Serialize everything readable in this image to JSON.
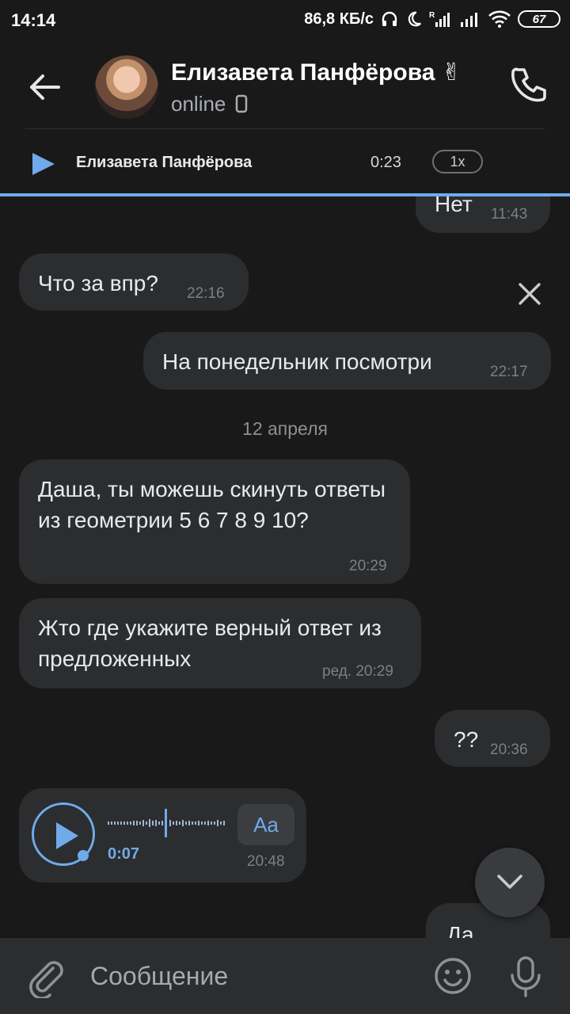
{
  "status_bar": {
    "time": "14:14",
    "network_speed": "86,8 КБ/с",
    "battery": "67"
  },
  "header": {
    "contact_name": "Елизавета Панфёрова ✌",
    "presence": "online"
  },
  "audio_player": {
    "title": "Елизавета Панфёрова",
    "time": "0:23",
    "speed": "1x"
  },
  "messages": [
    {
      "id": "m1",
      "direction": "out",
      "text": "Нет",
      "time": "11:43"
    },
    {
      "id": "m2",
      "direction": "in",
      "text": "Что за впр?",
      "time": "22:16"
    },
    {
      "id": "m3",
      "direction": "out",
      "text": "На понедельник посмотри",
      "time": "22:17"
    },
    {
      "id": "sep",
      "type": "date",
      "text": "12 апреля"
    },
    {
      "id": "m4",
      "direction": "in",
      "text": "Даша, ты можешь скинуть ответы из геометрии 5 6 7 8 9 10?",
      "time": "20:29"
    },
    {
      "id": "m5",
      "direction": "in",
      "text": "Жто где укажите верный ответ из предложенных",
      "time": "ред. 20:29"
    },
    {
      "id": "m6",
      "direction": "out",
      "text": "??",
      "time": "20:36"
    },
    {
      "id": "m7",
      "direction": "in",
      "type": "voice",
      "duration": "0:07",
      "transcribe_label": "Aa",
      "time": "20:48"
    },
    {
      "id": "m8",
      "direction": "out",
      "text": "Да"
    }
  ],
  "composer": {
    "placeholder": "Сообщение"
  },
  "colors": {
    "accent": "#71aaeb",
    "background": "#19191a",
    "bubble": "#2c2d2f"
  }
}
